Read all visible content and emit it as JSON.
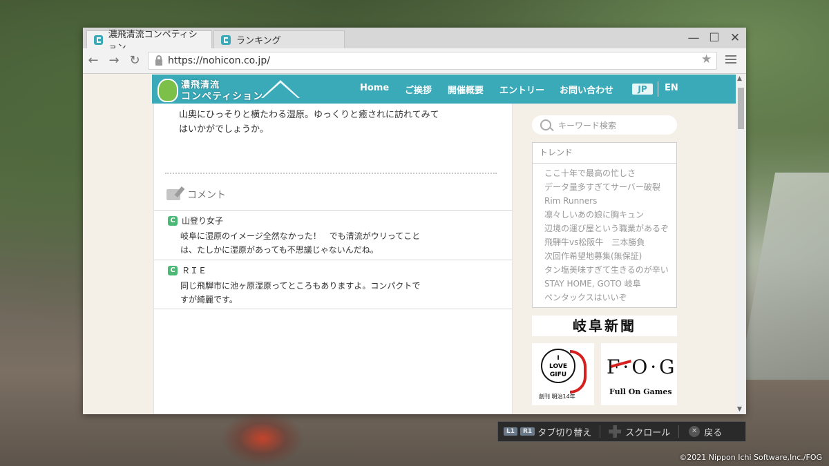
{
  "browser": {
    "tabs": [
      {
        "label": "濃飛清流コンペティション",
        "active": true
      },
      {
        "label": "ランキング",
        "active": false
      }
    ],
    "window_controls": {
      "minimize": "—",
      "maximize": "☐",
      "close": "✕"
    },
    "url": "https://nohicon.co.jp/"
  },
  "site": {
    "logo_line1": "濃飛清流",
    "logo_line2": "コンペティション",
    "nav": [
      "Home",
      "ご挨拶",
      "開催概要",
      "エントリー",
      "お問い合わせ"
    ],
    "lang": {
      "jp": "JP",
      "en": "EN"
    },
    "accent_color": "#3aa9b8"
  },
  "article": {
    "text_line1": "山奥にひっそりと横たわる湿原。ゆっくりと癒されに訪れてみて",
    "text_line2": "はいかがでしょうか。"
  },
  "comments": {
    "title": "コメント",
    "items": [
      {
        "name": "山登り女子",
        "line1": "岐阜に湿原のイメージ全然なかった！　でも清流がウリってこと",
        "line2": "は、たしかに湿原があっても不思議じゃないんだね。"
      },
      {
        "name": "ＲＩＥ",
        "line1": "同じ飛騨市に池ヶ原湿原ってところもありますよ。コンパクトで",
        "line2": "すが綺麗です。"
      }
    ]
  },
  "sidebar": {
    "search_placeholder": "キーワード検索",
    "trend_title": "トレンド",
    "trends": [
      "ここ十年で最高の忙しさ",
      "データ量多すぎてサーバー破裂",
      "Rim Runners",
      "凛々しいあの娘に胸キュン",
      "辺境の運び屋という職業があるぞ",
      "飛騨牛vs松阪牛　三本勝負",
      "次回作希望地募集(無保証)",
      "タン塩美味すぎて生きるのが辛い",
      "STAY HOME, GOTO 岐阜",
      "ペンタックスはいいぞ"
    ],
    "banner_news": "岐阜新聞",
    "banner_gifu": {
      "line1": "I",
      "heart": "♥",
      "line2": "LOVE",
      "line3": "GIFU",
      "sub": "創刊 明治14年"
    },
    "banner_fog": {
      "main": "F·O·G",
      "sub": "Full On Games"
    }
  },
  "hud": {
    "l1": "L1",
    "r1": "R1",
    "tab_switch": "タブ切り替え",
    "scroll": "スクロール",
    "back": "戻る"
  },
  "copyright": "©2021 Nippon Ichi Software,Inc./FOG"
}
